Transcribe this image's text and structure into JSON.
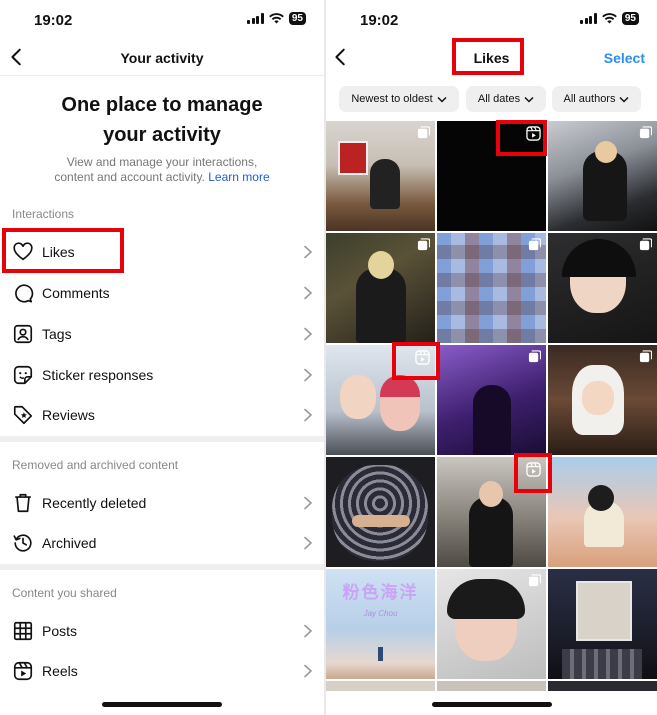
{
  "status": {
    "time": "19:02",
    "battery": "95"
  },
  "left": {
    "title": "Your activity",
    "hero_title_1": "One place to manage",
    "hero_title_2": "your activity",
    "hero_sub_1": "View and manage your interactions,",
    "hero_sub_2": "content and account activity.",
    "hero_link": "Learn more",
    "sections": {
      "interactions": "Interactions",
      "removed": "Removed and archived content",
      "shared": "Content you shared"
    },
    "items": {
      "likes": "Likes",
      "comments": "Comments",
      "tags": "Tags",
      "sticker": "Sticker responses",
      "reviews": "Reviews",
      "deleted": "Recently deleted",
      "archived": "Archived",
      "posts": "Posts",
      "reels": "Reels"
    }
  },
  "right": {
    "title": "Likes",
    "select": "Select",
    "filters": {
      "sort": "Newest to oldest",
      "dates": "All dates",
      "authors": "All authors"
    },
    "cover_title": "粉色海洋",
    "cover_sub": "Jay Chou"
  },
  "colors": {
    "accent": "#2b8ff0",
    "highlight": "#e8000b",
    "link": "#1b5fd6"
  }
}
